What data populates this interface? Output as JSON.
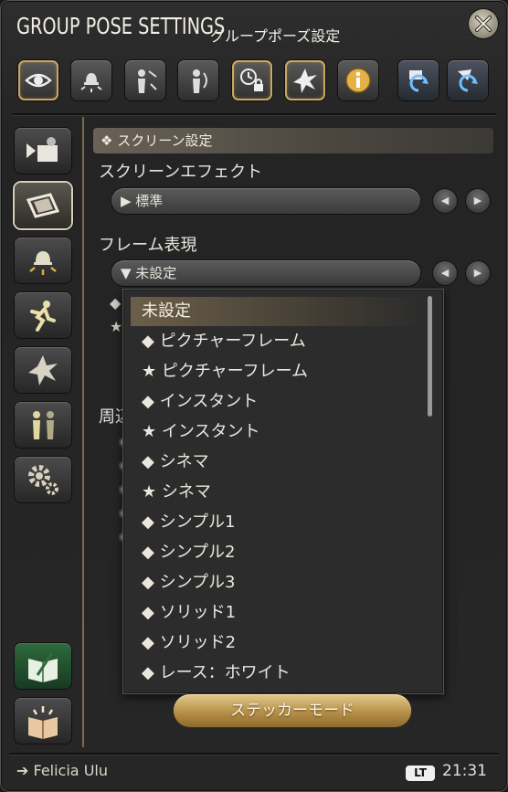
{
  "window": {
    "title": "GROUP POSE SETTINGS",
    "subtitle": "グループポーズ設定",
    "close_icon": "close-x-icon"
  },
  "toolbar": [
    {
      "name": "toolbar-eye-button",
      "icon": "eye-icon",
      "active": true
    },
    {
      "name": "toolbar-lighting-button",
      "icon": "lamp-icon",
      "active": false
    },
    {
      "name": "toolbar-character-button",
      "icon": "character-icon",
      "active": false
    },
    {
      "name": "toolbar-character-alt-button",
      "icon": "character-alt-icon",
      "active": false
    },
    {
      "name": "toolbar-time-lock-button",
      "icon": "clock-lock-icon",
      "active": true
    },
    {
      "name": "toolbar-effect-button",
      "icon": "burst-icon",
      "active": true
    },
    {
      "name": "toolbar-info-button",
      "icon": "info-icon",
      "active": false
    },
    {
      "name": "toolbar-reset-button",
      "icon": "reset-icon",
      "active": false
    },
    {
      "name": "toolbar-reset-alt-button",
      "icon": "reset-alt-icon",
      "active": false
    }
  ],
  "sidebar": [
    {
      "name": "side-camera-button",
      "icon": "camera-icon"
    },
    {
      "name": "side-screen-button",
      "icon": "screen-frame-icon",
      "active": true
    },
    {
      "name": "side-lighting-button",
      "icon": "lamp-icon"
    },
    {
      "name": "side-motion-button",
      "icon": "running-icon"
    },
    {
      "name": "side-effect-button",
      "icon": "burst-icon"
    },
    {
      "name": "side-group-button",
      "icon": "group-icon"
    },
    {
      "name": "side-settings-button",
      "icon": "gear-icon"
    },
    {
      "name": "side-journal-button",
      "icon": "book-pen-icon"
    },
    {
      "name": "side-guide-button",
      "icon": "book-light-icon"
    }
  ],
  "main": {
    "section_header": "❖ スクリーン設定",
    "screen_effect_label": "スクリーンエフェクト",
    "screen_effect_value": "▶ 標準",
    "frame_label": "フレーム表現",
    "frame_value": "▼ 未設定",
    "hidden_rows": [
      "◆",
      "★"
    ],
    "ambient_label": "周辺"
  },
  "popup": {
    "items": [
      "未設定",
      "◆ ピクチャーフレーム",
      "★ ピクチャーフレーム",
      "◆ インスタント",
      "★ インスタント",
      "◆ シネマ",
      "★ シネマ",
      "◆ シンプル1",
      "◆ シンプル2",
      "◆ シンプル3",
      "◆ ソリッド1",
      "◆ ソリッド2",
      "◆ レース：ホワイト"
    ],
    "selected_index": 0
  },
  "sticker_button": "ステッカーモード",
  "footer": {
    "character_name": "➔ Felicia Ulu",
    "lt_badge": "LT",
    "time": "21:31"
  },
  "colors": {
    "accent_gold": "#c9a767",
    "sticker_gold": "#b28b45"
  }
}
